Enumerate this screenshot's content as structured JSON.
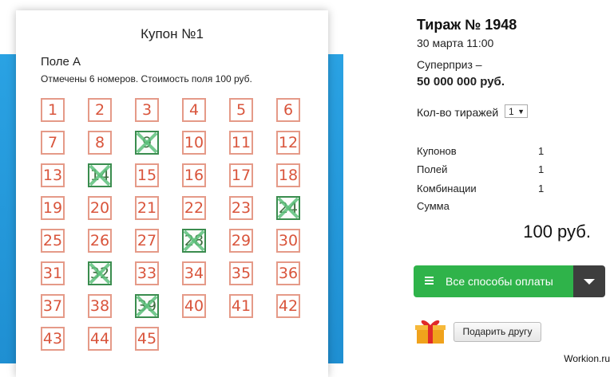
{
  "coupon": {
    "title": "Купон №1",
    "field_title": "Поле А",
    "field_desc": "Отмечены 6 номеров. Стоимость поля 100 руб.",
    "numbers": [
      {
        "n": "1"
      },
      {
        "n": "2"
      },
      {
        "n": "3"
      },
      {
        "n": "4"
      },
      {
        "n": "5"
      },
      {
        "n": "6"
      },
      {
        "n": "7"
      },
      {
        "n": "8"
      },
      {
        "n": "9",
        "sel": true
      },
      {
        "n": "10"
      },
      {
        "n": "11"
      },
      {
        "n": "12"
      },
      {
        "n": "13"
      },
      {
        "n": "14",
        "sel": true
      },
      {
        "n": "15"
      },
      {
        "n": "16"
      },
      {
        "n": "17"
      },
      {
        "n": "18"
      },
      {
        "n": "19"
      },
      {
        "n": "20"
      },
      {
        "n": "21"
      },
      {
        "n": "22"
      },
      {
        "n": "23"
      },
      {
        "n": "24",
        "sel": true
      },
      {
        "n": "25"
      },
      {
        "n": "26"
      },
      {
        "n": "27"
      },
      {
        "n": "28",
        "sel": true
      },
      {
        "n": "29"
      },
      {
        "n": "30"
      },
      {
        "n": "31"
      },
      {
        "n": "32",
        "sel": true
      },
      {
        "n": "33"
      },
      {
        "n": "34"
      },
      {
        "n": "35"
      },
      {
        "n": "36"
      },
      {
        "n": "37"
      },
      {
        "n": "38"
      },
      {
        "n": "39",
        "sel": true
      },
      {
        "n": "40"
      },
      {
        "n": "41"
      },
      {
        "n": "42"
      },
      {
        "n": "43"
      },
      {
        "n": "44"
      },
      {
        "n": "45"
      }
    ]
  },
  "draw": {
    "title": "Тираж № 1948",
    "date": "30 марта 11:00",
    "prize_label": "Суперприз –",
    "prize_value": "50 000 000 руб.",
    "count_label": "Кол-во тиражей",
    "count_value": "1"
  },
  "stats": [
    {
      "label": "Купонов",
      "value": "1"
    },
    {
      "label": "Полей",
      "value": "1"
    },
    {
      "label": "Комбинации",
      "value": "1"
    },
    {
      "label": "Сумма",
      "value": ""
    }
  ],
  "total": "100 руб.",
  "pay_button": "Все способы оплаты",
  "gift_button": "Подарить другу",
  "watermark": "Workion.ru",
  "colors": {
    "cell_border": "#e59a88",
    "cell_text": "#d9553c",
    "mark": "#5cc07a",
    "pay_green": "#2fb34a",
    "strip_blue": "#2aa2e3"
  }
}
